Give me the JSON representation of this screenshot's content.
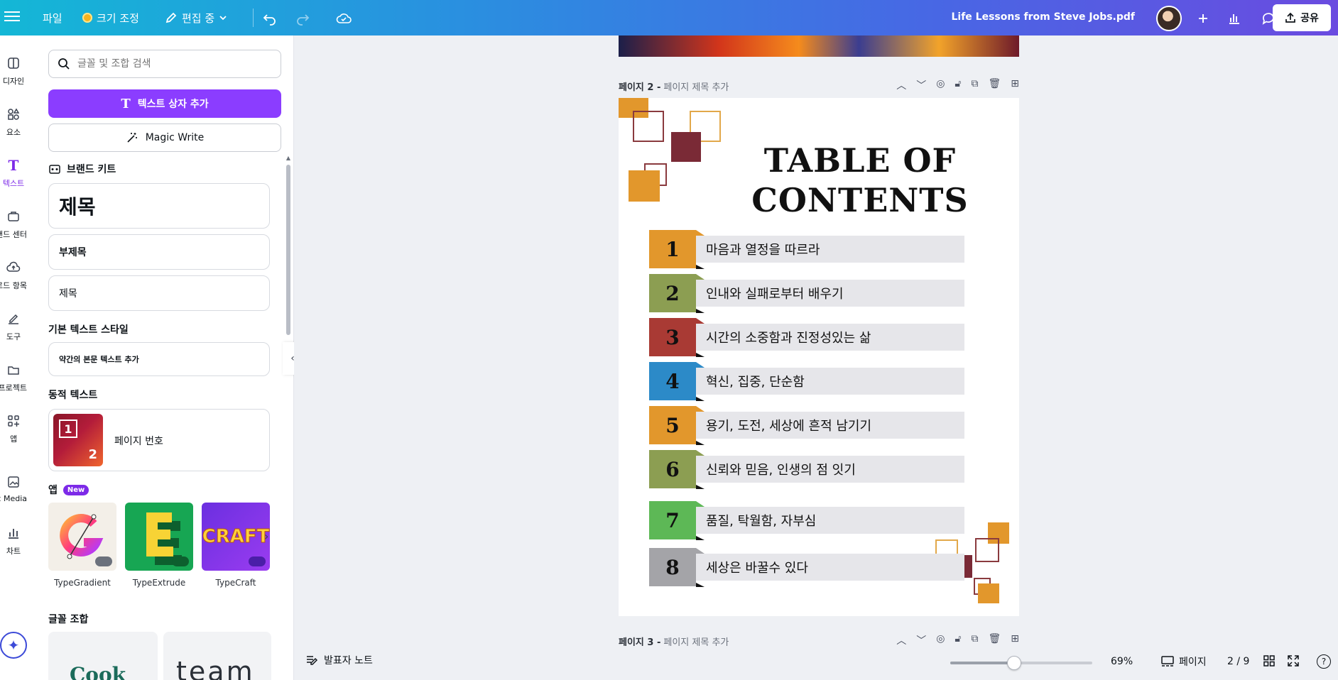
{
  "topbar": {
    "file": "파일",
    "resize": "크기 조정",
    "editing": "편집 중",
    "doc_title": "Life Lessons from Steve Jobs.pdf",
    "share": "공유"
  },
  "rail": [
    {
      "label": "디자인",
      "icon": "design-icon"
    },
    {
      "label": "요소",
      "icon": "elements-icon"
    },
    {
      "label": "텍스트",
      "icon": "text-icon"
    },
    {
      "label": "브랜드 센터",
      "icon": "brand-icon"
    },
    {
      "label": "업로드 항목",
      "icon": "upload-icon"
    },
    {
      "label": "도구",
      "icon": "draw-icon"
    },
    {
      "label": "프로젝트",
      "icon": "folder-icon"
    },
    {
      "label": "앱",
      "icon": "apps-icon"
    },
    {
      "label": "Magic Media",
      "icon": "magic-media-icon"
    },
    {
      "label": "차트",
      "icon": "chart-icon"
    }
  ],
  "panel": {
    "search_placeholder": "글꼴 및 조합 검색",
    "add_textbox": "텍스트 상자 추가",
    "magic_write": "Magic Write",
    "brand_kit": "브랜드 키트",
    "brand_styles": [
      "제목",
      "부제목",
      "제목"
    ],
    "basic_styles": "기본 텍스트 스타일",
    "body_text": "약간의 본문 텍스트 추가",
    "dynamic_text": "동적 텍스트",
    "page_number": "페이지 번호",
    "page_number_thumb": [
      "1",
      "2"
    ],
    "apps": "앱",
    "new_badge": "New",
    "app_items": [
      "TypeGradient",
      "TypeExtrude",
      "TypeCraft"
    ],
    "font_combos": "글꼴 조합",
    "combo_previews": [
      "Cook",
      "team"
    ]
  },
  "canvas": {
    "page2_label": "페이지 2 -",
    "page2_add_title": "페이지 제목 추가",
    "page3_label": "페이지 3 -",
    "page3_add_title": "페이지 제목 추가",
    "toc_title_line1": "TABLE OF",
    "toc_title_line2": "CONTENTS",
    "toc": [
      {
        "num": "1",
        "text": "마음과 열정을 따르라",
        "color": "#e2972c"
      },
      {
        "num": "2",
        "text": "인내와 실패로부터 배우기",
        "color": "#8c9e52"
      },
      {
        "num": "3",
        "text": "시간의 소중함과 진정성있는 삶",
        "color": "#a93a34"
      },
      {
        "num": "4",
        "text": "혁신, 집중, 단순함",
        "color": "#2c8ac8"
      },
      {
        "num": "5",
        "text": "용기, 도전, 세상에 흔적 남기기",
        "color": "#e2972c"
      },
      {
        "num": "6",
        "text": "신뢰와 믿음, 인생의 점 잇기",
        "color": "#8c9e52"
      },
      {
        "num": "7",
        "text": "품질, 탁월함, 자부심",
        "color": "#5db856"
      },
      {
        "num": "8",
        "text": "세상은 바꿀수 있다",
        "color": "#a4a4a8"
      }
    ]
  },
  "bottom": {
    "notes": "발표자 노트",
    "zoom": "69%",
    "zoom_level": 0.45,
    "pages": "페이지",
    "page_count": "2 / 9"
  },
  "colors": {
    "accent": "#8b3dff",
    "orange": "#e2972c",
    "maroon": "#7a2a36"
  }
}
